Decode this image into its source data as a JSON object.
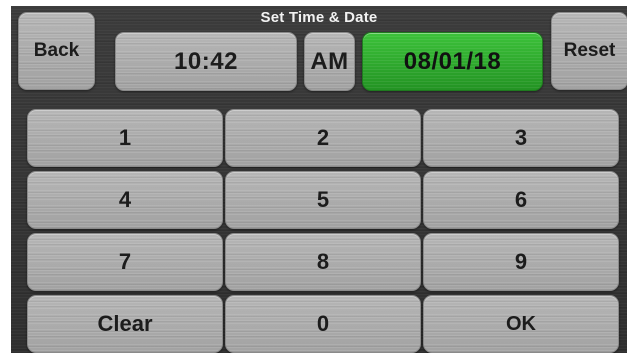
{
  "header": {
    "title": "Set Time & Date"
  },
  "top_bar": {
    "back_label": "Back",
    "time_value": "10:42",
    "ampm_value": "AM",
    "date_value": "08/01/18",
    "reset_label": "Reset"
  },
  "keypad": {
    "key_1": "1",
    "key_2": "2",
    "key_3": "3",
    "key_4": "4",
    "key_5": "5",
    "key_6": "6",
    "key_7": "7",
    "key_8": "8",
    "key_9": "9",
    "clear_label": "Clear",
    "key_0": "0",
    "ok_label": "OK"
  },
  "colors": {
    "background": "#353535",
    "button_gray": "#aaaaaa",
    "selected_green": "#2fa82d",
    "title_text": "#f2f2f2"
  }
}
